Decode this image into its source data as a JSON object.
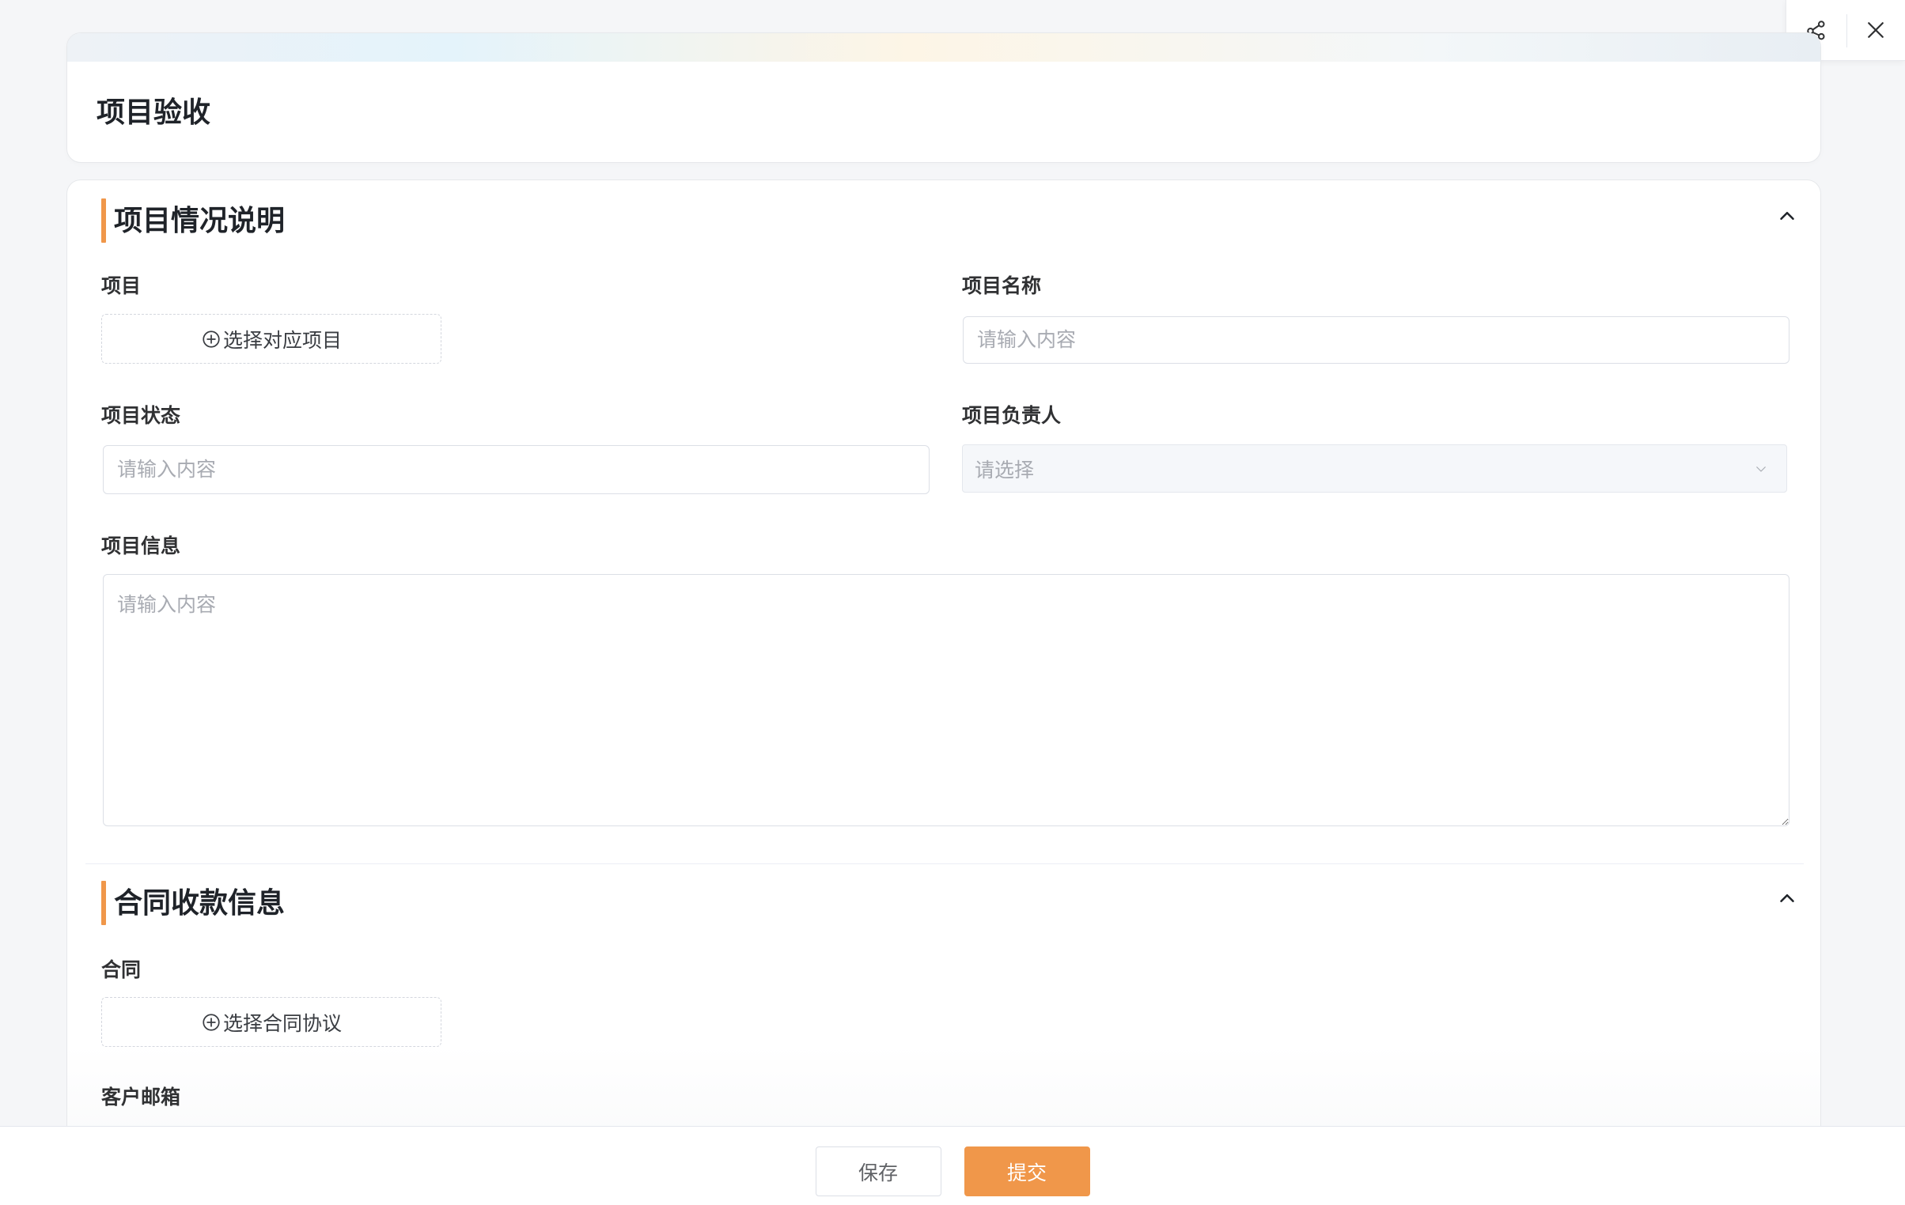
{
  "page": {
    "title": "项目验收"
  },
  "toolbar": {
    "share_icon": "share-icon",
    "close_icon": "close-icon"
  },
  "sections": {
    "project": {
      "title": "项目情况说明",
      "collapse_icon": "chevron-up-icon",
      "project_label": "项目",
      "select_project_button": "选择对应项目",
      "project_name_label": "项目名称",
      "project_name_placeholder": "请输入内容",
      "project_status_label": "项目状态",
      "project_status_placeholder": "请输入内容",
      "project_owner_label": "项目负责人",
      "project_owner_placeholder": "请选择",
      "project_info_label": "项目信息",
      "project_info_placeholder": "请输入内容"
    },
    "contract": {
      "title": "合同收款信息",
      "collapse_icon": "chevron-up-icon",
      "contract_label": "合同",
      "select_contract_button": "选择合同协议",
      "customer_email_label": "客户邮箱"
    }
  },
  "footer": {
    "save_label": "保存",
    "submit_label": "提交"
  },
  "colors": {
    "accent": "#f0974a",
    "label": "#303133",
    "placeholder": "#a8abb2",
    "border": "#dcdfe6",
    "background": "#f5f6f8"
  }
}
